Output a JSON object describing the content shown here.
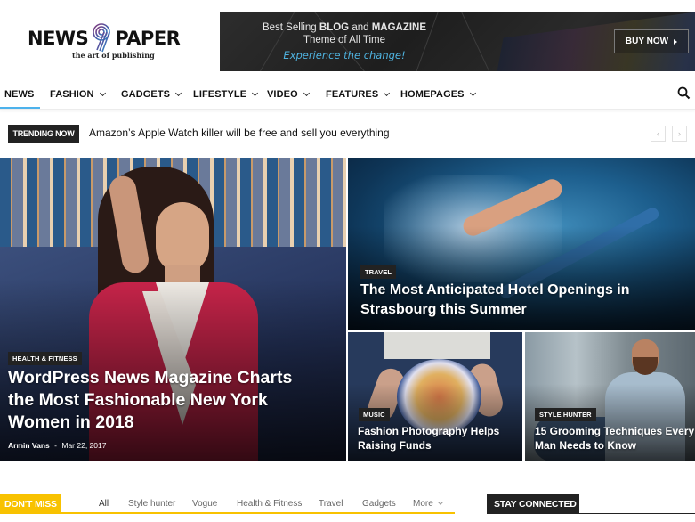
{
  "logo": {
    "left_word": "NEWS",
    "right_word": "PAPER",
    "tagline": "the art of publishing"
  },
  "banner": {
    "line1_prefix": "Best Selling ",
    "line1_bold1": "BLOG",
    "line1_mid": " and ",
    "line1_bold2": "MAGAZINE",
    "line2": "Theme of All Time",
    "script": "Experience the change!",
    "button_label": "BUY NOW"
  },
  "nav": {
    "items": [
      {
        "label": "NEWS",
        "has_dropdown": false,
        "active": true
      },
      {
        "label": "FASHION",
        "has_dropdown": true
      },
      {
        "label": "GADGETS",
        "has_dropdown": true
      },
      {
        "label": "LIFESTYLE",
        "has_dropdown": true
      },
      {
        "label": "VIDEO",
        "has_dropdown": true
      },
      {
        "label": "FEATURES",
        "has_dropdown": true
      },
      {
        "label": "HOMEPAGES",
        "has_dropdown": true
      }
    ],
    "search_icon": "search-icon",
    "active_color": "#4db2ec"
  },
  "trending": {
    "label": "TRENDING NOW",
    "headline": "Amazon’s Apple Watch killer will be free and sell you everything",
    "prev": "‹",
    "next": "›"
  },
  "featured": [
    {
      "category": "HEALTH & FITNESS",
      "title": "WordPress News Magazine Charts the Most Fashionable New York Women in 2018",
      "author": "Armin Vans",
      "separator": "-",
      "date": "Mar 22, 2017"
    },
    {
      "category": "TRAVEL",
      "title": "The Most Anticipated Hotel Openings in Strasbourg this Summer"
    },
    {
      "category": "MUSIC",
      "title": "Fashion Photography Helps Raising Funds"
    },
    {
      "category": "STYLE HUNTER",
      "title": "15 Grooming Techniques Every Man Needs to Know"
    }
  ],
  "dont_miss": {
    "label": "DON'T MISS",
    "accent": "#f8c200",
    "tabs": [
      "All",
      "Style hunter",
      "Vogue",
      "Health & Fitness",
      "Travel",
      "Gadgets",
      "More"
    ]
  },
  "stay_connected": {
    "label": "STAY CONNECTED"
  }
}
